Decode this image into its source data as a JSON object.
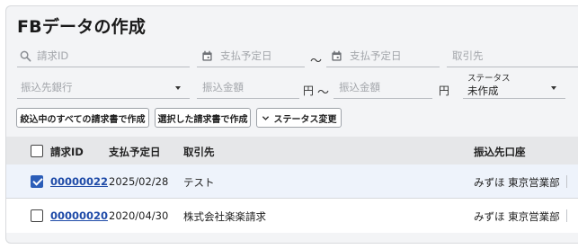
{
  "page": {
    "title": "FBデータの作成"
  },
  "filters": {
    "invoice_id_placeholder": "請求ID",
    "due_date_from_placeholder": "支払予定日",
    "range_separator": "～",
    "due_date_to_placeholder": "支払予定日",
    "vendor_placeholder": "取引先",
    "bank_placeholder": "振込先銀行",
    "amount_min_placeholder": "振込金額",
    "amount_unit": "円",
    "amount_max_placeholder": "振込金額",
    "status_label": "ステータス",
    "status_value": "未作成"
  },
  "actions": {
    "bulk_create_all": "絞込中のすべての請求書で作成",
    "create_selected": "選択した請求書で作成",
    "change_status": "ステータス変更"
  },
  "table": {
    "headers": [
      "請求ID",
      "支払予定日",
      "取引先",
      "振込先口座"
    ],
    "rows": [
      {
        "checked": true,
        "id": "00000022",
        "due": "2025/02/28",
        "vendor": "テスト",
        "account": "みずほ 東京営業部"
      },
      {
        "checked": false,
        "id": "00000020",
        "due": "2020/04/30",
        "vendor": "株式会社楽楽請求",
        "account": "みずほ 東京営業部"
      }
    ]
  },
  "colors": {
    "accent": "#2b5db8",
    "link": "#1f4ba8",
    "header_bg": "#e6e7e9",
    "selected_row_bg": "#eef3fb"
  },
  "icons": [
    "search-icon",
    "calendar-icon",
    "chevron-down-icon",
    "checkbox-icon"
  ]
}
